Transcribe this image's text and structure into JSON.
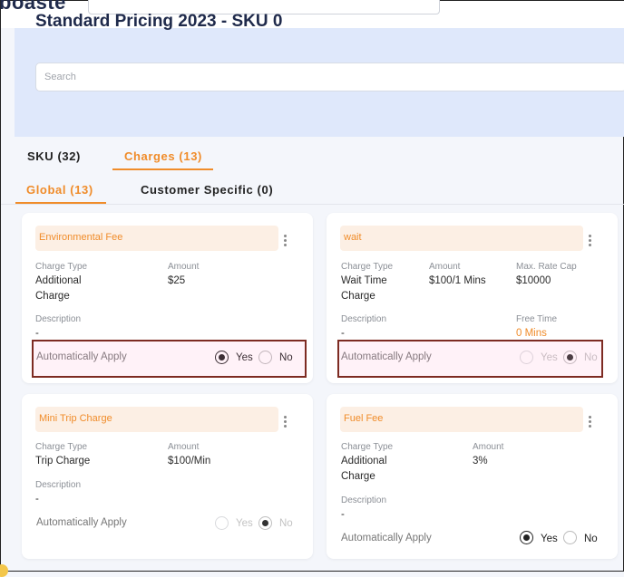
{
  "app": {
    "logo_text": "boaste"
  },
  "page": {
    "title": "Standard Pricing 2023 - SKU 0"
  },
  "search": {
    "placeholder": "Search"
  },
  "tabs": [
    {
      "label": "SKU (32)"
    },
    {
      "label": "Charges (13)"
    }
  ],
  "subtabs": [
    {
      "label": "Global (13)"
    },
    {
      "label": "Customer Specific (0)"
    }
  ],
  "labels": {
    "charge_type": "Charge Type",
    "amount": "Amount",
    "max_rate_cap": "Max. Rate Cap",
    "description": "Description",
    "free_time": "Free Time",
    "automatically_apply": "Automatically Apply",
    "yes": "Yes",
    "no": "No"
  },
  "cards": [
    {
      "name": "Environmental Fee",
      "charge_type": "Additional Charge",
      "amount": "$25",
      "description": "-",
      "auto_apply": "Yes",
      "radio_enabled": true
    },
    {
      "name": "wait",
      "charge_type": "Wait Time Charge",
      "amount": "$100/1 Mins",
      "max_rate_cap": "$10000",
      "description": "-",
      "free_time": "0 Mins",
      "auto_apply": "No",
      "radio_enabled": false
    },
    {
      "name": "Mini Trip Charge",
      "charge_type": "Trip Charge",
      "amount": "$100/Min",
      "description": "-",
      "auto_apply": "No",
      "radio_enabled": false
    },
    {
      "name": "Fuel Fee",
      "charge_type": "Additional Charge",
      "amount": "3%",
      "description": "-",
      "auto_apply": "Yes",
      "radio_enabled": true
    }
  ],
  "colors": {
    "accent": "#f08c2a",
    "highlight_border": "#7d2b22",
    "hero_bg": "#dfe8fb"
  }
}
